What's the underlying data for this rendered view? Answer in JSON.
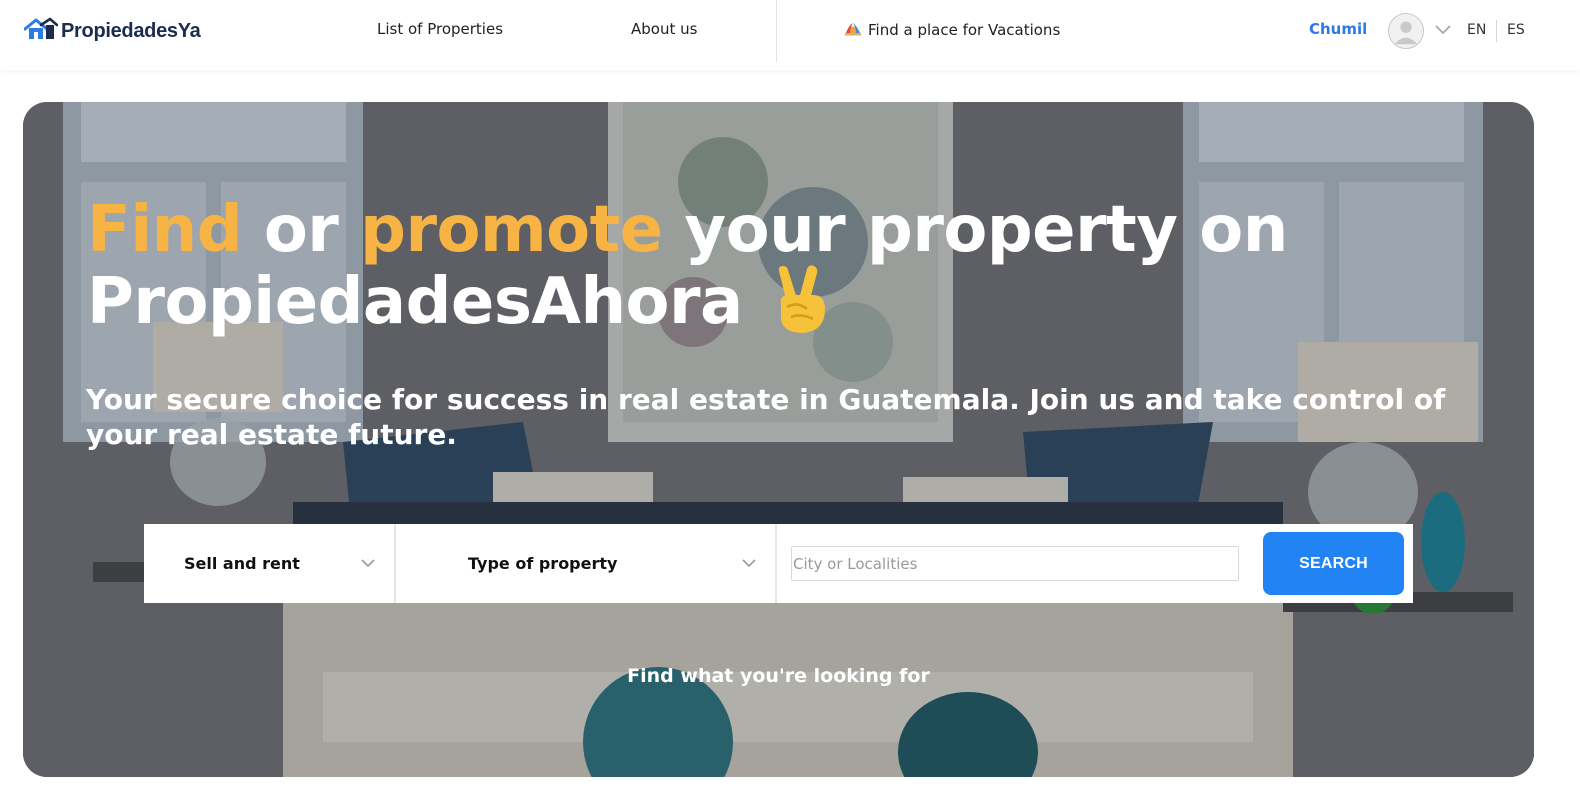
{
  "header": {
    "logo_text": "PropiedadesYa",
    "nav": {
      "list_properties": "List of Properties",
      "about_us": "About us",
      "vacations": "Find a place for Vacations"
    },
    "user_name": "Chumil",
    "languages": [
      "EN",
      "ES"
    ]
  },
  "hero": {
    "headline": {
      "word1": "Find",
      "word2": " or ",
      "word3": "promote",
      "word4": " your property on",
      "line2": "PropiedadesAhora"
    },
    "subheadline": "Your secure choice for success in real estate in Guatemala. Join us and take control of your real estate future.",
    "search": {
      "operation_label": "Sell and rent",
      "property_type_label": "Type of property",
      "city_placeholder": "City or Localities",
      "search_button": "SEARCH"
    },
    "tagline": "Find what you're looking for"
  },
  "colors": {
    "brand_blue": "#2283f5",
    "accent_orange": "#f7b444",
    "user_name_blue": "#2b7ae6"
  },
  "icons": [
    "logo-house-icon",
    "vacation-icon",
    "user-avatar-icon",
    "chevron-down-icon",
    "victory-hand-emoji"
  ]
}
